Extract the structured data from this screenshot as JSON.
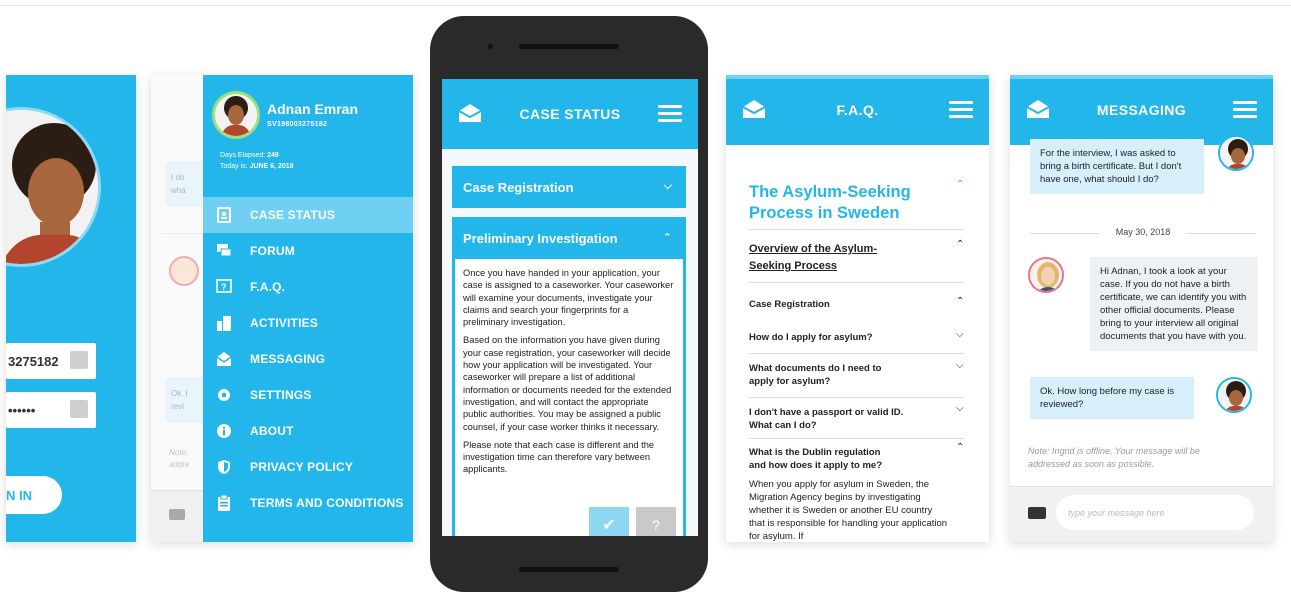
{
  "login": {
    "username_value": "3275182",
    "password_value": "••••••",
    "signin_label": "N IN"
  },
  "chat_sliver": {
    "bubble_1": "I do\nwha",
    "bubble_2": "Ok. l\nrevi",
    "note": "Note:\naddre"
  },
  "menu": {
    "user_name": "Adnan Emran",
    "user_id": "SV198003275182",
    "days_elapsed_label": "Days Elapsed:",
    "days_elapsed_value": "249",
    "today_label": "Today is:",
    "today_value": "JUNE 6, 2018",
    "items": [
      {
        "label": "CASE STATUS",
        "icon": "id-card-icon"
      },
      {
        "label": "FORUM",
        "icon": "chat-bubbles-icon"
      },
      {
        "label": "F.A.Q.",
        "icon": "question-icon"
      },
      {
        "label": "ACTIVITIES",
        "icon": "building-icon"
      },
      {
        "label": "MESSAGING",
        "icon": "envelope-icon"
      },
      {
        "label": "SETTINGS",
        "icon": "gear-icon"
      },
      {
        "label": "ABOUT",
        "icon": "info-icon"
      },
      {
        "label": "PRIVACY POLICY",
        "icon": "shield-icon"
      },
      {
        "label": "TERMS AND CONDITIONS",
        "icon": "clipboard-icon"
      }
    ]
  },
  "case_status": {
    "title": "CASE STATUS",
    "section_1": "Case Registration",
    "section_2": "Preliminary Investigation",
    "para_1": "Once you have handed in your application, your case is assigned to a caseworker. Your caseworker will examine your documents, investigate your claims and search your fingerprints for a preliminary investigation.",
    "para_2": "Based on the information you have given during your case registration, your caseworker will decide how your application will be investigated. Your caseworker will prepare a list of additional information or documents needed for the extended investigation, and will contact the appropriate public authorities. You may be assigned a public counsel, if your case worker thinks it necessary.",
    "para_3": "Please note that each case is different and the investigation time can therefore vary between applicants.",
    "confirm_glyph": "✔",
    "help_glyph": "?"
  },
  "faq": {
    "title": "F.A.Q.",
    "heading": "The Asylum-Seeking Process in Sweden",
    "overview": "Overview of the Asylum-Seeking Process",
    "case_registration": "Case Registration",
    "q1": "How do I apply for asylum?",
    "q2": "What documents do I need to apply for asylum?",
    "q3": "I don't have a passport or valid ID. What can I do?",
    "q4": "What is the Dublin regulation and how does it apply to me?",
    "answer": "When you apply for asylum in Sweden, the Migration Agency begins by investigating whether it is Sweden or another EU country that is responsible for handling your application for asylum. If"
  },
  "messaging": {
    "title": "MESSAGING",
    "msg_1": "For the interview, I was asked to bring a birth certificate. But I don't have one, what should I do?",
    "date": "May 30, 2018",
    "msg_2": "Hi Adnan, I took a look at your case. If you do not have a birth certificate, we can identify you with other official documents. Please bring to your interview all  original documents that you have with you.",
    "msg_3": "Ok. How long before my case is reviewed?",
    "note": "Note: Ingrid is offline. Your message will be addressed as soon as possible.",
    "input_placeholder": "type your message here"
  },
  "colors": {
    "brand_blue": "#22b6ea",
    "active_item": "#6fd0f3",
    "bubble_me": "#d6effa",
    "bubble_them": "#eef1f3"
  }
}
